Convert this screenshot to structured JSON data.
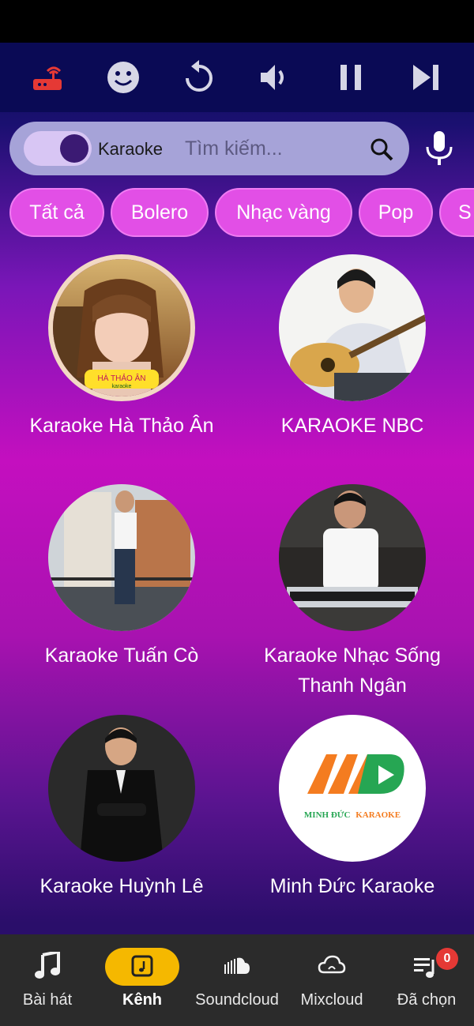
{
  "toolbar": {
    "icons": [
      "router-icon",
      "emoji-icon",
      "replay-icon",
      "volume-icon",
      "pause-icon",
      "skip-next-icon"
    ],
    "router_color": "#e53935"
  },
  "search": {
    "toggle_label": "Karaoke",
    "placeholder": "Tìm kiếm..."
  },
  "chips": [
    "Tất cả",
    "Bolero",
    "Nhạc vàng",
    "Pop",
    "S"
  ],
  "channels": [
    {
      "name": "Karaoke Hà Thảo Ân"
    },
    {
      "name": "KARAOKE NBC"
    },
    {
      "name": "Karaoke Tuấn Cò"
    },
    {
      "name": "Karaoke Nhạc Sống Thanh Ngân"
    },
    {
      "name": "Karaoke Huỳnh Lê"
    },
    {
      "name": "Minh Đức Karaoke"
    }
  ],
  "logos": {
    "ha_thao_an_line1": "HÀ THẢO ÂN",
    "ha_thao_an_line2": "karaoke",
    "minh_duc_letters": "MD",
    "minh_duc_name1": "MINH ĐỨC",
    "minh_duc_name2": "KARAOKE"
  },
  "bottom_nav": [
    {
      "label": "Bài hát",
      "icon": "music-note-icon"
    },
    {
      "label": "Kênh",
      "icon": "channel-icon",
      "active": true
    },
    {
      "label": "Soundcloud",
      "icon": "soundcloud-icon"
    },
    {
      "label": "Mixcloud",
      "icon": "mixcloud-icon"
    },
    {
      "label": "Đã chọn",
      "icon": "queue-icon",
      "badge": "0"
    }
  ],
  "colors": {
    "accent": "#f5b800",
    "chip": "#e24fe6",
    "badge": "#e53935"
  }
}
